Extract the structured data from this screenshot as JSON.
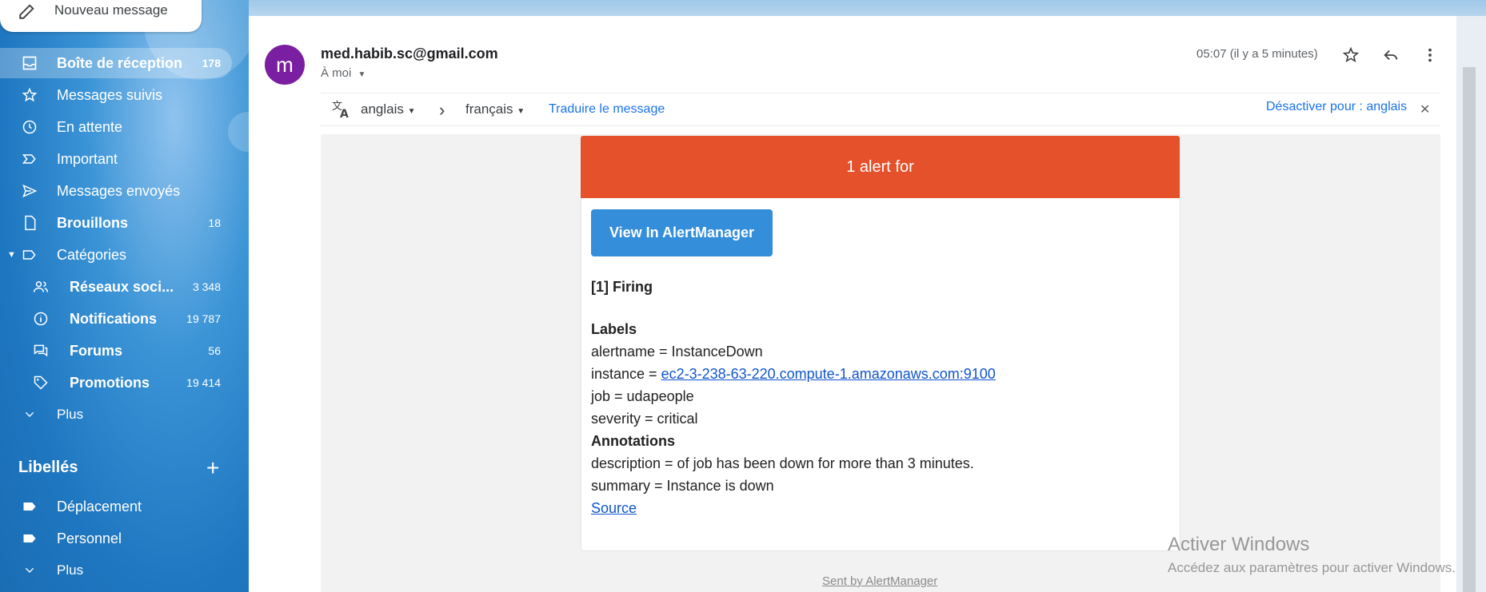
{
  "compose": {
    "label": "Nouveau message"
  },
  "nav": [
    {
      "label": "Boîte de réception",
      "count": "178",
      "icon": "inbox-icon"
    },
    {
      "label": "Messages suivis",
      "count": "",
      "icon": "star-icon"
    },
    {
      "label": "En attente",
      "count": "",
      "icon": "clock-icon"
    },
    {
      "label": "Important",
      "count": "",
      "icon": "important-icon"
    },
    {
      "label": "Messages envoyés",
      "count": "",
      "icon": "send-icon"
    },
    {
      "label": "Brouillons",
      "count": "18",
      "icon": "draft-icon"
    },
    {
      "label": "Catégories",
      "count": "",
      "icon": "label-icon"
    }
  ],
  "categories": [
    {
      "label": "Réseaux soci...",
      "count": "3 348",
      "icon": "people-icon"
    },
    {
      "label": "Notifications",
      "count": "19 787",
      "icon": "info-icon"
    },
    {
      "label": "Forums",
      "count": "56",
      "icon": "forum-icon"
    },
    {
      "label": "Promotions",
      "count": "19 414",
      "icon": "tag-icon"
    }
  ],
  "more_label": "Plus",
  "labels_section": {
    "title": "Libellés",
    "items": [
      "Déplacement",
      "Personnel"
    ],
    "more": "Plus"
  },
  "message": {
    "avatar_letter": "m",
    "sender": "med.habib.sc@gmail.com",
    "to": "À moi",
    "time": "05:07 (il y a 5 minutes)"
  },
  "translate": {
    "from": "anglais",
    "to": "français",
    "action": "Traduire le message",
    "disable": "Désactiver pour : anglais"
  },
  "alert": {
    "header": "1 alert for",
    "button": "View In AlertManager",
    "firing": "[1] Firing",
    "labels_title": "Labels",
    "alertname": "alertname = InstanceDown",
    "instance_prefix": "instance = ",
    "instance_link": "ec2-3-238-63-220.compute-1.amazonaws.com:9100",
    "job": "job = udapeople",
    "severity": "severity = critical",
    "annotations_title": "Annotations",
    "description": "description = of job has been down for more than 3 minutes.",
    "summary": "summary = Instance is down",
    "source": "Source",
    "footer": "Sent by AlertManager"
  },
  "watermark": {
    "title": "Activer Windows",
    "subtitle": "Accédez aux paramètres pour activer Windows."
  },
  "colors": {
    "alert_header": "#e4512b",
    "button": "#348eda",
    "avatar": "#7b1fa2",
    "link": "#1a73e8"
  }
}
